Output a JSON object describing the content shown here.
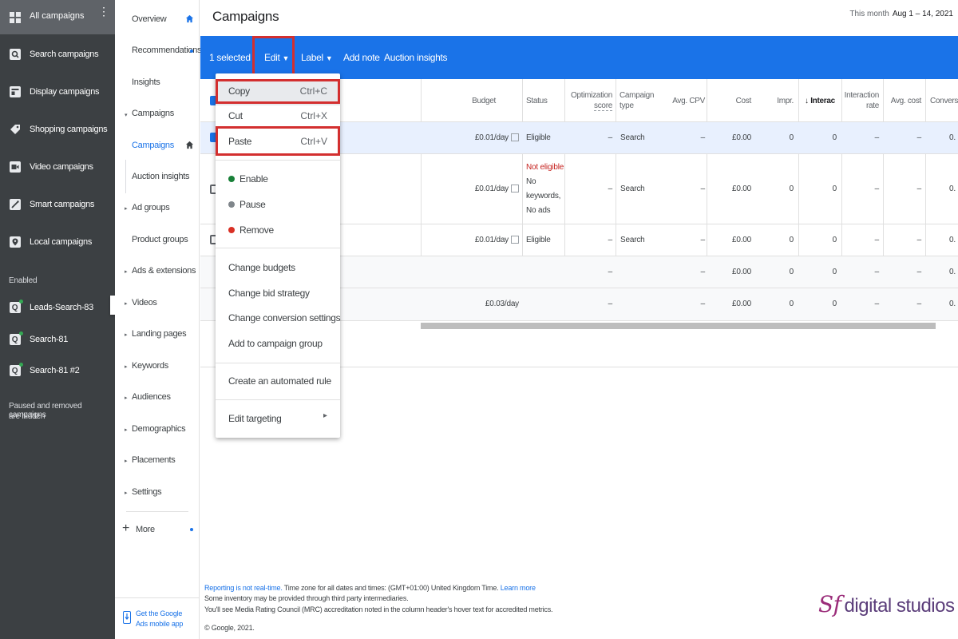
{
  "sidebar": {
    "title": "All campaigns",
    "items": [
      {
        "label": "Search campaigns",
        "icon": "search-icon"
      },
      {
        "label": "Display campaigns",
        "icon": "display-icon"
      },
      {
        "label": "Shopping campaigns",
        "icon": "shopping-icon"
      },
      {
        "label": "Video campaigns",
        "icon": "video-icon"
      },
      {
        "label": "Smart campaigns",
        "icon": "smart-icon"
      },
      {
        "label": "Local campaigns",
        "icon": "location-icon"
      }
    ],
    "section_label": "Enabled",
    "campaigns": [
      {
        "label": "Leads-Search-83"
      },
      {
        "label": "Search-81"
      },
      {
        "label": "Search-81 #2"
      }
    ],
    "hidden_note_1": "Paused and removed campaigns",
    "hidden_note_2": "are hidden"
  },
  "nav": {
    "items": [
      {
        "label": "Overview"
      },
      {
        "label": "Recommendations"
      },
      {
        "label": "Insights"
      },
      {
        "label": "Campaigns"
      },
      {
        "label": "Campaigns"
      },
      {
        "label": "Auction insights"
      },
      {
        "label": "Ad groups"
      },
      {
        "label": "Product groups"
      },
      {
        "label": "Ads & extensions"
      },
      {
        "label": "Videos"
      },
      {
        "label": "Landing pages"
      },
      {
        "label": "Keywords"
      },
      {
        "label": "Audiences"
      },
      {
        "label": "Demographics"
      },
      {
        "label": "Placements"
      },
      {
        "label": "Settings"
      }
    ],
    "more": "More",
    "mobile_1": "Get the Google",
    "mobile_2": "Ads mobile app"
  },
  "header": {
    "title": "Campaigns",
    "date_label": "This month",
    "date_range": "Aug 1 – 14, 2021"
  },
  "toolbar": {
    "selected": "1 selected",
    "edit": "Edit",
    "label": "Label",
    "add_note": "Add note",
    "auction_insights": "Auction insights"
  },
  "table": {
    "columns": [
      "Budget",
      "Status",
      "Optimization score",
      "Campaign type",
      "Avg. CPV",
      "Cost",
      "Impr.",
      "Interac",
      "Interaction rate",
      "Avg. cost",
      "Conversio"
    ],
    "col_opt_1": "Optimization",
    "col_opt_2": "score",
    "col_type_1": "Campaign",
    "col_type_2": "type",
    "col_ir_1": "Interaction",
    "col_ir_2": "rate",
    "rows": [
      {
        "budget": "£0.01/day",
        "status": "Eligible",
        "opt": "–",
        "type": "Search",
        "cpv": "–",
        "cost": "£0.00",
        "impr": "0",
        "inter": "0",
        "irate": "–",
        "avgcost": "–",
        "conv": "0."
      },
      {
        "budget": "£0.01/day",
        "status": "Not eligible",
        "status_sub_1": "No",
        "status_sub_2": "keywords,",
        "status_sub_3": "No ads",
        "opt": "–",
        "type": "Search",
        "cpv": "–",
        "cost": "£0.00",
        "impr": "0",
        "inter": "0",
        "irate": "–",
        "avgcost": "–",
        "conv": "0."
      },
      {
        "budget": "£0.01/day",
        "status": "Eligible",
        "opt": "–",
        "type": "Search",
        "cpv": "–",
        "cost": "£0.00",
        "impr": "0",
        "inter": "0",
        "irate": "–",
        "avgcost": "–",
        "conv": "0."
      },
      {
        "budget": "",
        "status": "",
        "opt": "–",
        "type": "",
        "cpv": "–",
        "cost": "£0.00",
        "impr": "0",
        "inter": "0",
        "irate": "–",
        "avgcost": "–",
        "conv": "0."
      },
      {
        "budget": "£0.03/day",
        "status": "",
        "opt": "–",
        "type": "",
        "cpv": "–",
        "cost": "£0.00",
        "impr": "0",
        "inter": "0",
        "irate": "–",
        "avgcost": "–",
        "conv": "0."
      }
    ]
  },
  "menu": {
    "copy": "Copy",
    "copy_sc": "Ctrl+C",
    "cut": "Cut",
    "cut_sc": "Ctrl+X",
    "paste": "Paste",
    "paste_sc": "Ctrl+V",
    "enable": "Enable",
    "pause": "Pause",
    "remove": "Remove",
    "change_budgets": "Change budgets",
    "change_bid": "Change bid strategy",
    "change_conv": "Change conversion settings",
    "add_group": "Add to campaign group",
    "auto_rule": "Create an automated rule",
    "edit_targeting": "Edit targeting"
  },
  "footer": {
    "realtime": "Reporting is not real-time.",
    "timezone": " Time zone for all dates and times: (GMT+01:00) United Kingdom Time. ",
    "learn": "Learn more",
    "line2": "Some inventory may be provided through third party intermediaries.",
    "line3": "You'll see Media Rating Council (MRC) accreditation noted in the column header's hover text for accredited metrics.",
    "copyright": "© Google, 2021."
  },
  "watermark": {
    "logo": "Sf",
    "text": "digital studios"
  },
  "colors": {
    "accent": "#1a73e8",
    "highlight": "#d32f2f",
    "sidebar": "#3c4043",
    "eligible_dot": "#188038",
    "pause_dot": "#80868b",
    "remove_dot": "#d93025",
    "not_eligible": "#c5221f"
  }
}
